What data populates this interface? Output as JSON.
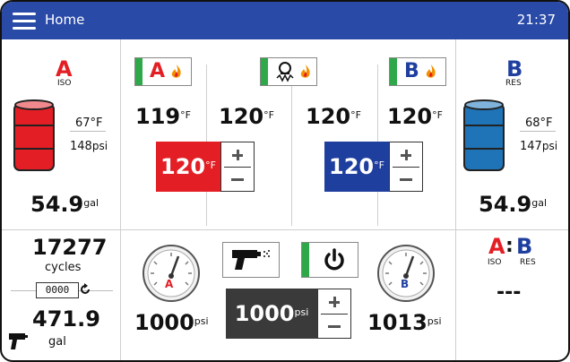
{
  "header": {
    "title": "Home",
    "time": "21:37"
  },
  "iso": {
    "letter": "A",
    "tag": "ISO",
    "temp": "67°F",
    "pressure": "148",
    "pressure_unit": "psi",
    "volume": "54.9",
    "volume_unit": "gal",
    "drum_color": "#e31e24"
  },
  "res": {
    "letter": "B",
    "tag": "RES",
    "temp": "68°F",
    "pressure": "147",
    "pressure_unit": "psi",
    "volume": "54.9",
    "volume_unit": "gal",
    "drum_color": "#1f73b7"
  },
  "heaters": {
    "a_label": "A",
    "b_label": "B",
    "readings": [
      {
        "value": "119",
        "unit": "°F"
      },
      {
        "value": "120",
        "unit": "°F"
      },
      {
        "value": "120",
        "unit": "°F"
      },
      {
        "value": "120",
        "unit": "°F"
      }
    ],
    "a_setpoint": {
      "value": "120",
      "unit": "°F"
    },
    "b_setpoint": {
      "value": "120",
      "unit": "°F"
    }
  },
  "counter": {
    "cycles": "17277",
    "cycles_label": "cycles",
    "reset_display": "0000",
    "total": "471.9",
    "total_unit": "gal"
  },
  "pumps": {
    "a_pressure": "1000",
    "a_unit": "psi",
    "a_gauge_label": "A",
    "b_pressure": "1013",
    "b_unit": "psi",
    "b_gauge_label": "B",
    "setpoint": "1000",
    "setpoint_unit": "psi"
  },
  "ratio": {
    "a": "A",
    "colon": ":",
    "b": "B",
    "a_tag": "ISO",
    "b_tag": "RES",
    "value": "---"
  },
  "colors": {
    "header_bg": "#2a4aa8",
    "iso_red": "#e31e24",
    "res_blue": "#1f3f9f",
    "power_green": "#2fa84a",
    "setpoint_dark": "#3a3a3a"
  }
}
